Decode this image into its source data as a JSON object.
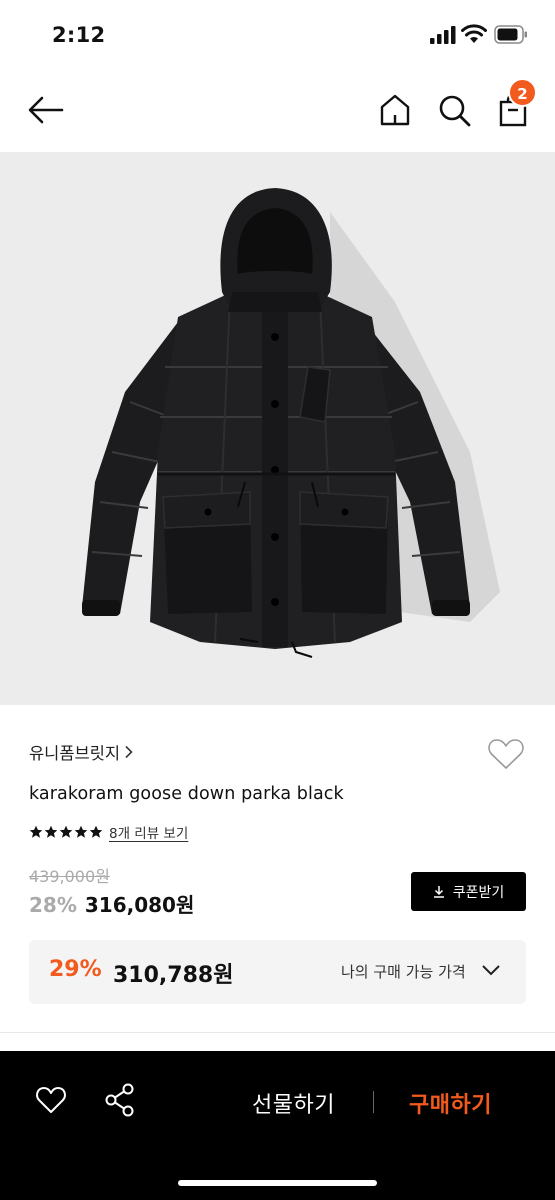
{
  "status_bar": {
    "time": "2:12"
  },
  "top_nav": {
    "cart_count": "2"
  },
  "product": {
    "brand": "유니폼브릿지",
    "title": "karakoram goose down parka black",
    "rating_stars": 5,
    "review_link": "8개 리뷰 보기",
    "original_price": "439,000원",
    "discount_rate": "28%",
    "sale_price": "316,080원",
    "coupon_label": "쿠폰받기"
  },
  "my_price": {
    "rate": "29%",
    "price": "310,788원",
    "label": "나의 구매 가능 가격"
  },
  "bottom_bar": {
    "gift_label": "선물하기",
    "buy_label": "구매하기"
  },
  "colors": {
    "accent": "#f25a1e",
    "bottom_bar_bg": "#000000",
    "image_bg": "#ececec"
  },
  "icons": [
    "back-arrow-icon",
    "home-icon",
    "search-icon",
    "shopping-bag-icon",
    "heart-icon",
    "star-icon",
    "download-icon",
    "chevron-down-icon",
    "share-icon"
  ]
}
